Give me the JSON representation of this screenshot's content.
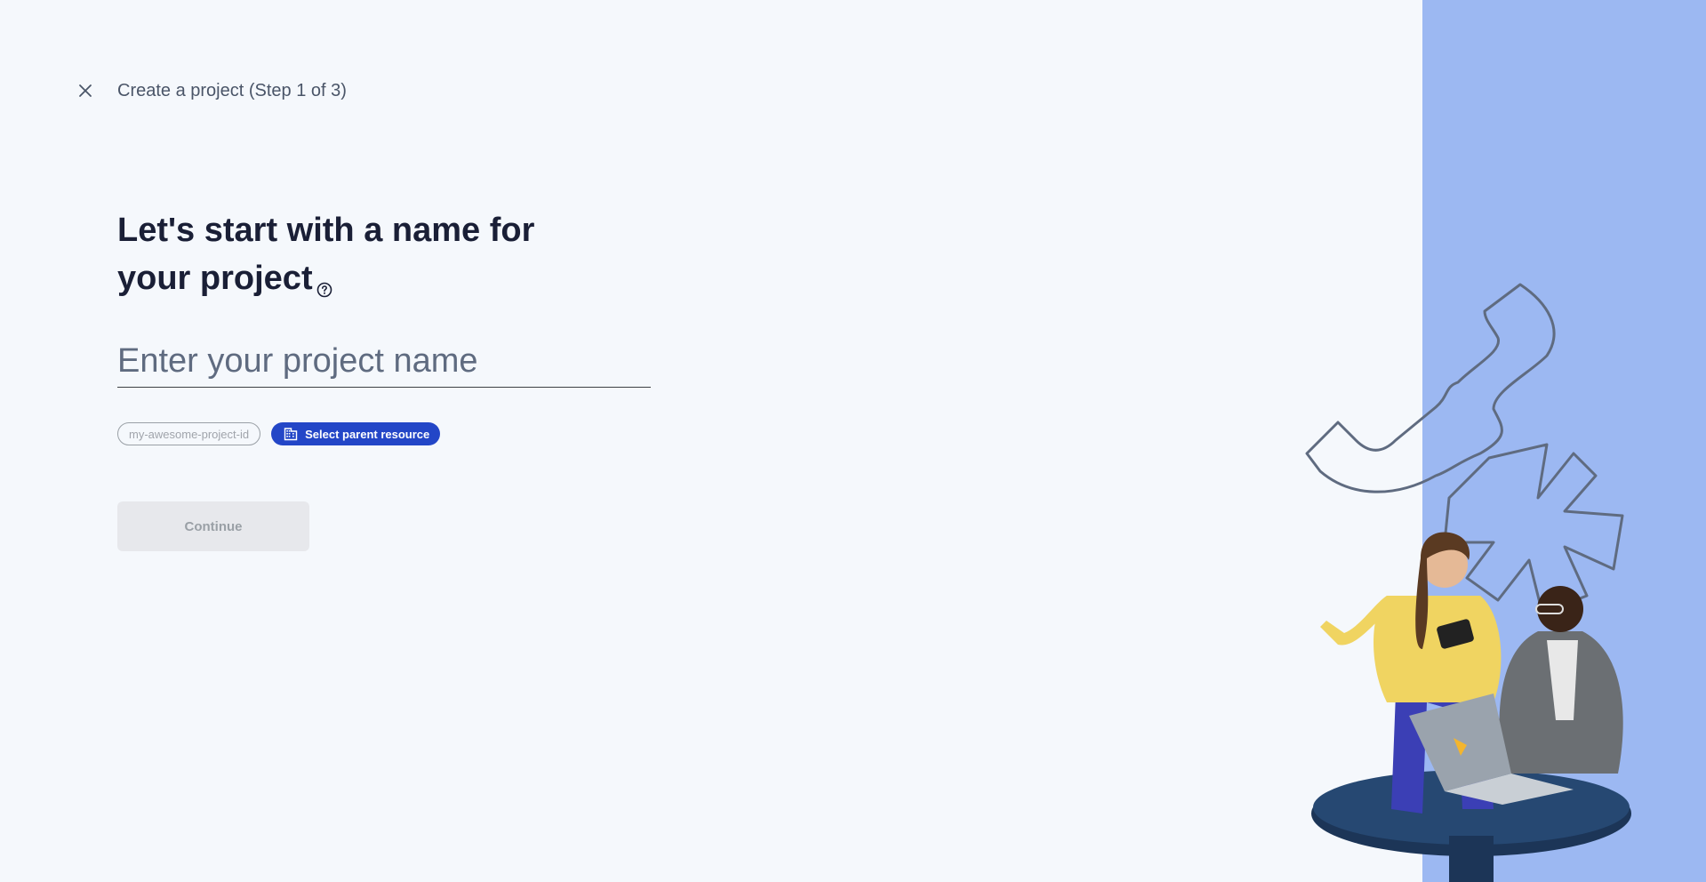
{
  "header": {
    "close_icon": "close-icon",
    "title": "Create a project (Step 1 of 3)"
  },
  "main": {
    "heading_line1": "Let's start with a name for",
    "heading_line2": "your project",
    "help_icon": "help-circle-icon",
    "name_input": {
      "placeholder": "Enter your project name",
      "value": ""
    },
    "project_id_chip": "my-awesome-project-id",
    "parent_resource_chip": {
      "label": "Select parent resource",
      "icon": "building-icon"
    },
    "continue_label": "Continue"
  },
  "colors": {
    "background": "#f5f8fc",
    "right_panel": "#9cb8f2",
    "primary": "#2346c7",
    "disabled_button": "#e7e8ec"
  }
}
